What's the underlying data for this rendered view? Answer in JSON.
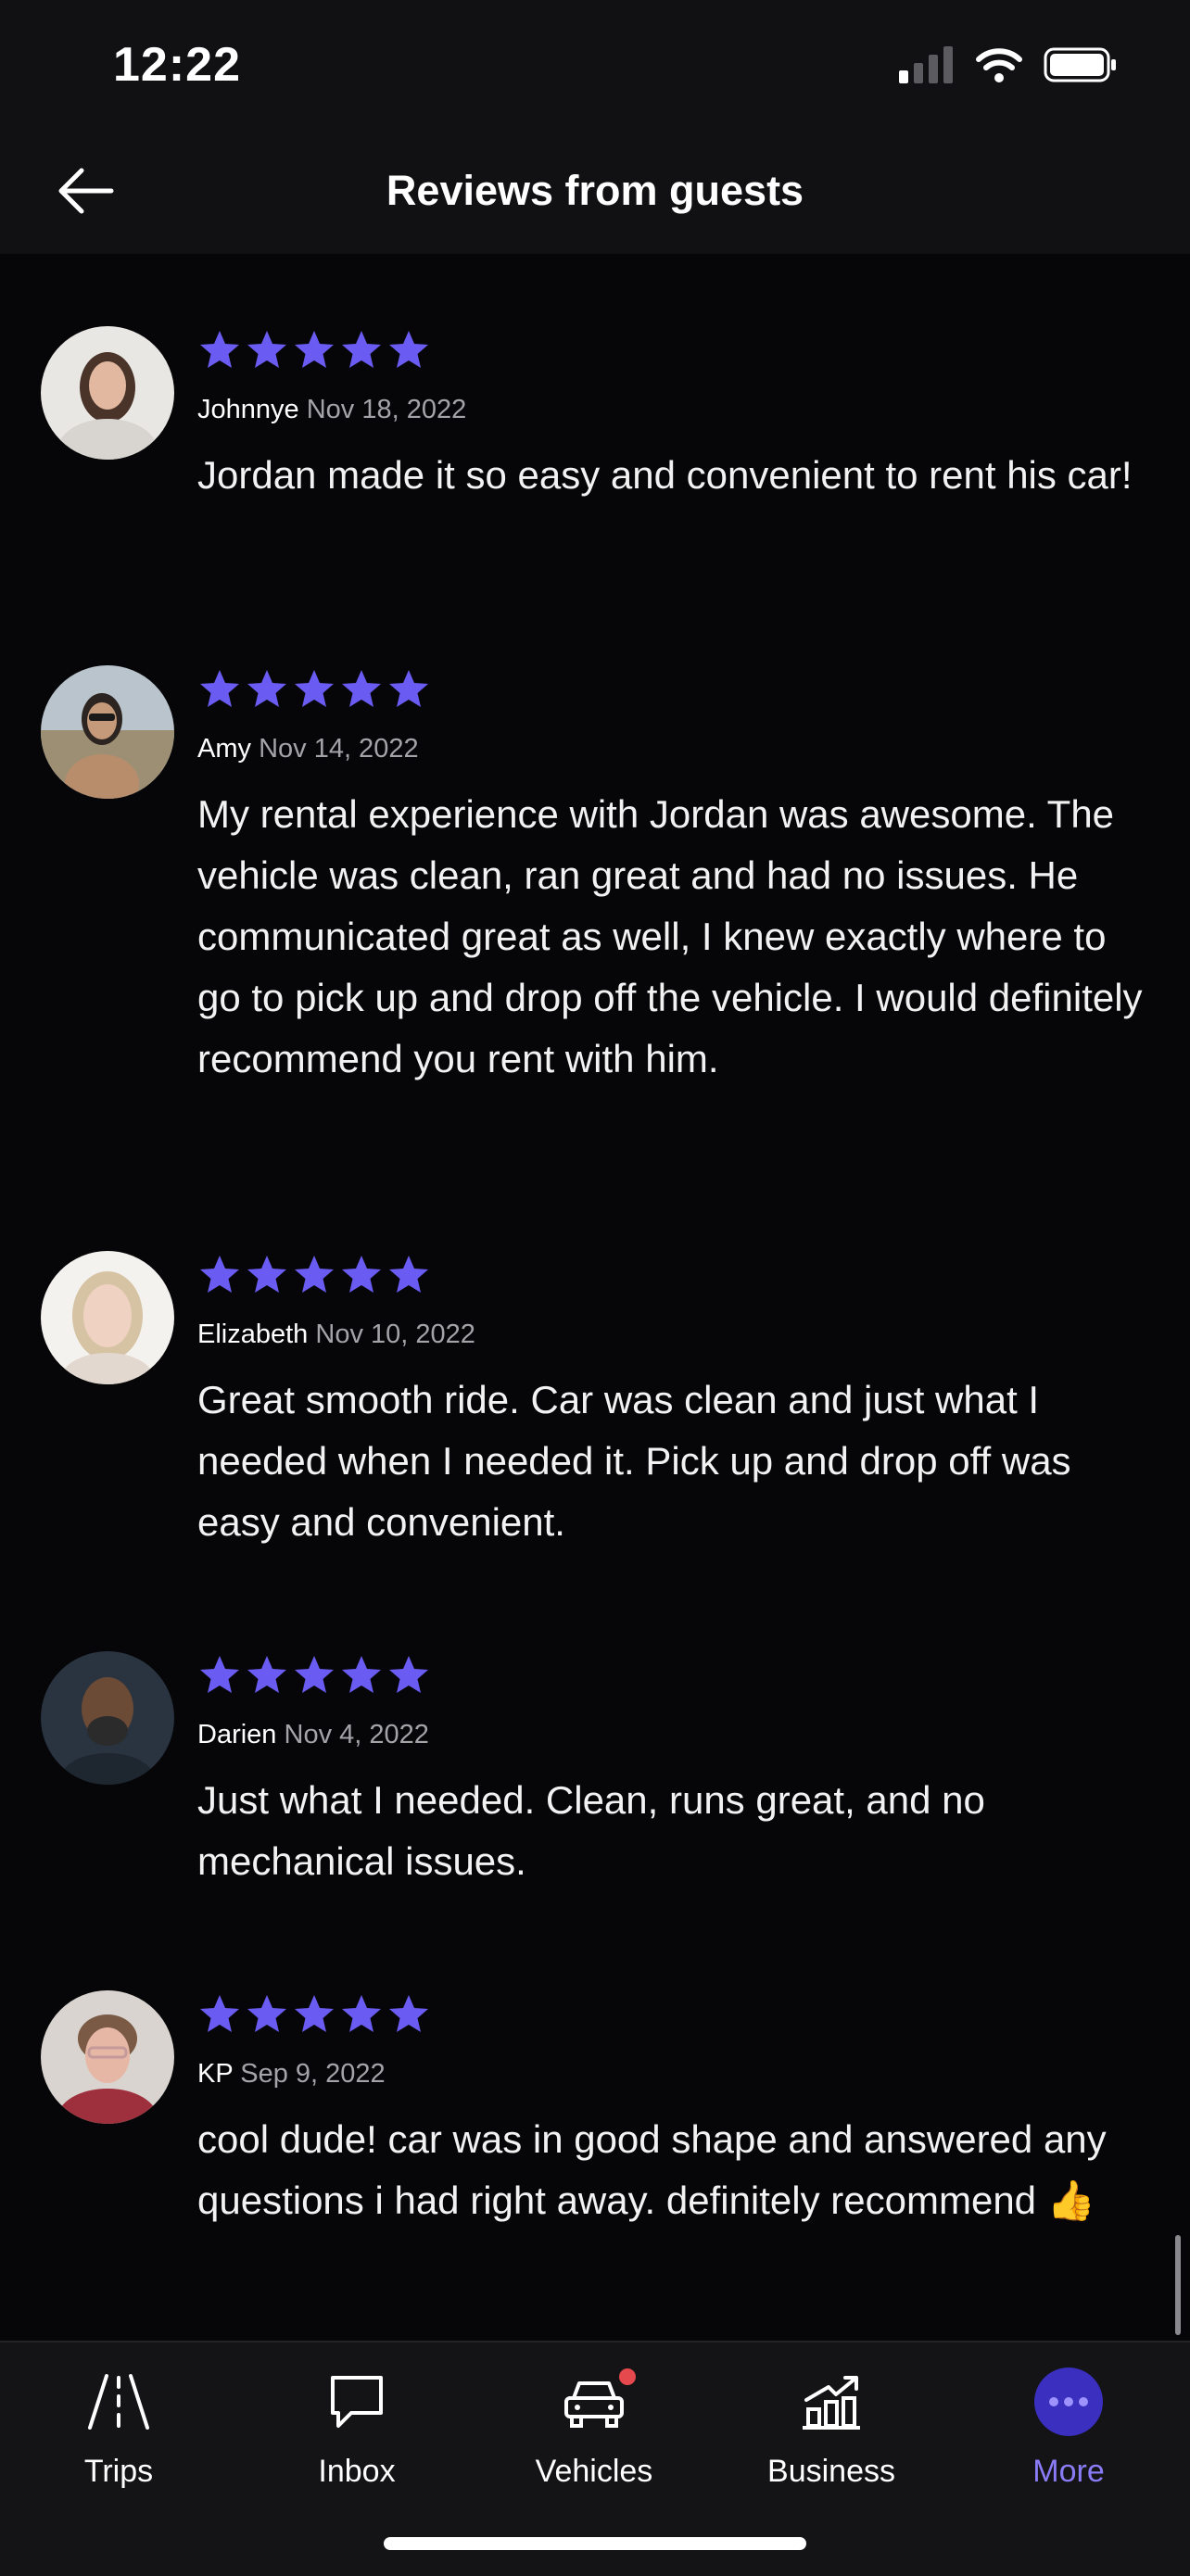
{
  "status": {
    "time": "12:22"
  },
  "header": {
    "title": "Reviews from guests",
    "back_icon": "arrow-left-icon"
  },
  "colors": {
    "star": "#6a5cf2",
    "accent": "#8a7cf7",
    "badge": "#e5484d"
  },
  "reviews": [
    {
      "name": "Johnnye",
      "date": "Nov 18, 2022",
      "rating": 5,
      "text": "Jordan made it so easy and convenient to rent his car!"
    },
    {
      "name": "Amy",
      "date": "Nov 14, 2022",
      "rating": 5,
      "text": "My rental experience with Jordan was awesome. The vehicle was clean, ran great and had no issues. He communicated great as well, I knew exactly where to go to pick up and drop off the vehicle. I would definitely recommend you rent with him."
    },
    {
      "name": "Elizabeth",
      "date": "Nov 10, 2022",
      "rating": 5,
      "text": "Great smooth ride. Car was clean and just what I needed when I needed it. Pick up and drop off was easy and convenient."
    },
    {
      "name": "Darien",
      "date": "Nov 4, 2022",
      "rating": 5,
      "text": "Just what I needed. Clean, runs great, and no mechanical issues."
    },
    {
      "name": "KP",
      "date": "Sep 9, 2022",
      "rating": 5,
      "text": "cool dude! car was in good shape and answered any questions i had right away. definitely recommend 👍"
    }
  ],
  "tabs": [
    {
      "label": "Trips",
      "icon": "road-icon",
      "active": false
    },
    {
      "label": "Inbox",
      "icon": "chat-bubble-icon",
      "active": false
    },
    {
      "label": "Vehicles",
      "icon": "car-icon",
      "active": false,
      "badge": true
    },
    {
      "label": "Business",
      "icon": "chart-growth-icon",
      "active": false
    },
    {
      "label": "More",
      "icon": "more-dots-icon",
      "active": true
    }
  ]
}
